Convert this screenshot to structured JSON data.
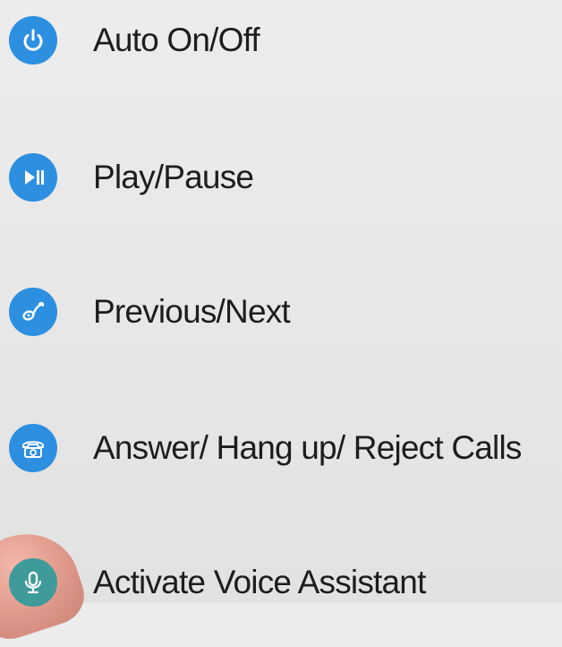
{
  "accent_color": "#2d8fe0",
  "features": [
    {
      "label": "Auto On/Off",
      "icon": "power-icon",
      "color": "#2d8fe0"
    },
    {
      "label": "Play/Pause",
      "icon": "play-pause-icon",
      "color": "#2d8fe0"
    },
    {
      "label": "Previous/Next",
      "icon": "music-note-icon",
      "color": "#2d8fe0"
    },
    {
      "label": "Answer/ Hang up/ Reject Calls",
      "icon": "telephone-icon",
      "color": "#2d8fe0"
    },
    {
      "label": "Activate Voice Assistant",
      "icon": "microphone-icon",
      "color": "#3f9a9a"
    }
  ]
}
